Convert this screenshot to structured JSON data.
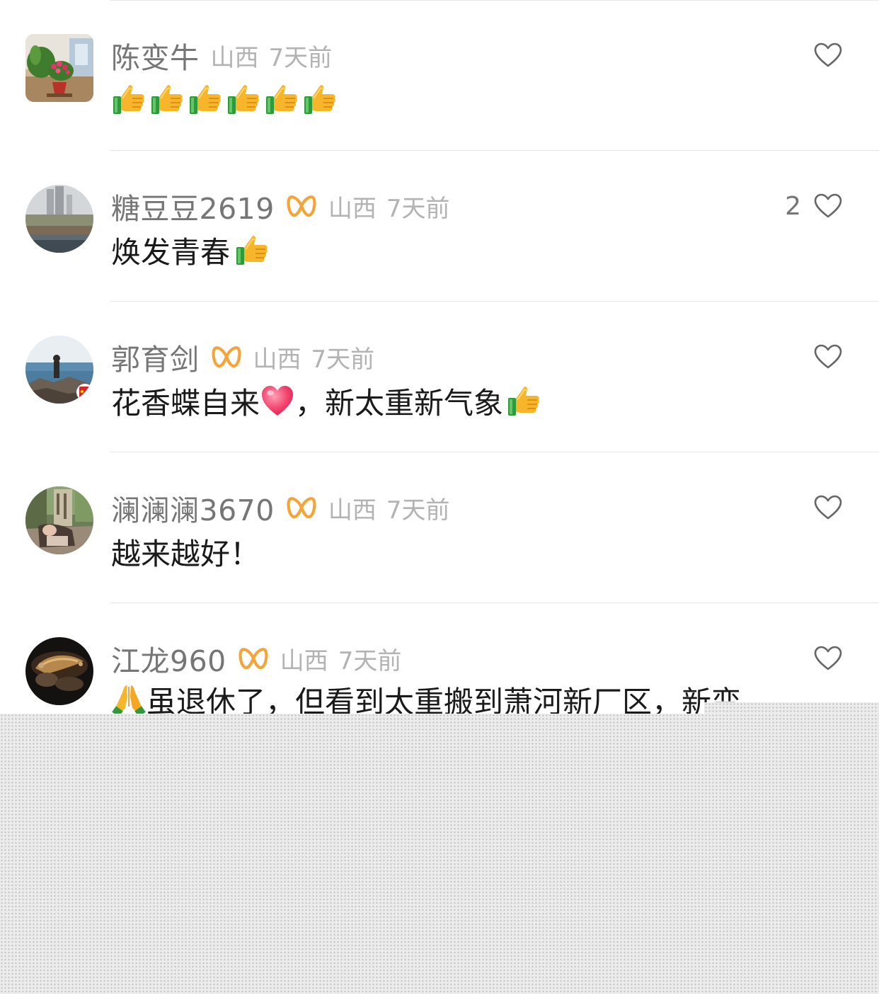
{
  "comments": [
    {
      "username": "陈变牛",
      "has_badge": false,
      "region": "山西",
      "time": "7天前",
      "content_text": "",
      "content_emoji": [
        "thumbs-up",
        "thumbs-up",
        "thumbs-up",
        "thumbs-up",
        "thumbs-up",
        "thumbs-up"
      ],
      "like_count": ""
    },
    {
      "username": "糖豆豆2619",
      "has_badge": true,
      "region": "山西",
      "time": "7天前",
      "content_text": "焕发青春",
      "content_emoji": [
        "thumbs-up"
      ],
      "like_count": "2"
    },
    {
      "username": "郭育剑",
      "has_badge": true,
      "region": "山西",
      "time": "7天前",
      "content_text_1": "花香蝶自来",
      "content_text_2": "，新太重新气象",
      "content_emoji": [
        "heart",
        "thumbs-up"
      ],
      "like_count": ""
    },
    {
      "username": "澜澜澜3670",
      "has_badge": true,
      "region": "山西",
      "time": "7天前",
      "content_text": "越来越好！",
      "like_count": ""
    },
    {
      "username": "江龙960",
      "has_badge": true,
      "region": "山西",
      "time": "7天前",
      "content_text": "虽退休了，但看到太重搬到萧河新厂区，新变",
      "content_emoji": [
        "folded-hands"
      ],
      "like_count": ""
    }
  ],
  "icons": {
    "like": "heart-outline-icon",
    "badge": "infinity-badge-icon"
  },
  "colors": {
    "badge": "#f5a43a",
    "username": "#767676",
    "meta": "#b3b3b3",
    "content": "#1a1a1a",
    "heart_outline": "#666666"
  }
}
